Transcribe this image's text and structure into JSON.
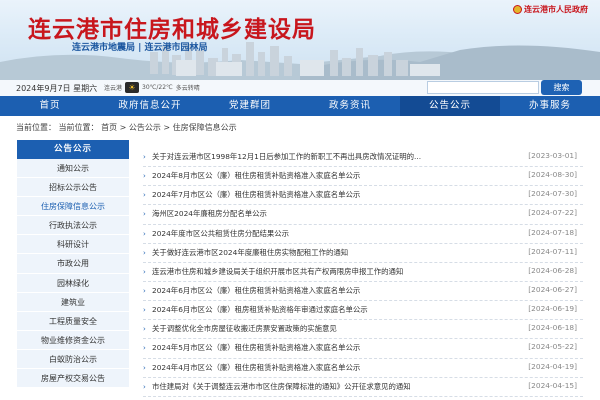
{
  "header": {
    "site_title": "连云港市住房和城乡建设局",
    "site_subtitle": "连云港市地震局 | 连云港市园林局",
    "gov_link": "连云港市人民政府"
  },
  "infobar": {
    "date": "2024年9月7日 星期六",
    "city": "连云港",
    "temperature": "30℃/22℃",
    "weather": "多云转晴",
    "search_placeholder": "",
    "search_label": "搜索"
  },
  "nav": {
    "items": [
      "首页",
      "政府信息公开",
      "党建群团",
      "政务资讯",
      "公告公示",
      "办事服务"
    ],
    "active_index": 4
  },
  "breadcrumb": "当前位置：  当前位置： 首页 > 公告公示 > 住房保障信息公示",
  "sidebar": {
    "title": "公告公示",
    "items": [
      "通知公示",
      "招标公示公告",
      "住房保障信息公示",
      "行政执法公示",
      "科研设计",
      "市政公用",
      "园林绿化",
      "建筑业",
      "工程质量安全",
      "物业维修资金公示",
      "白蚁防治公示",
      "房屋产权交易公告"
    ],
    "active_index": 2
  },
  "list": [
    {
      "title": "关于对连云港市区1998年12月1日后参加工作的新职工不再出具房改情况证明的...",
      "date": "[2023-03-01]"
    },
    {
      "title": "2024年8月市区公（廉）租住房租赁补贴资格准入家庭名单公示",
      "date": "[2024-08-30]"
    },
    {
      "title": "2024年7月市区公（廉）租住房租赁补贴资格准入家庭名单公示",
      "date": "[2024-07-30]"
    },
    {
      "title": "海州区2024年廉租房分配名单公示",
      "date": "[2024-07-22]"
    },
    {
      "title": "2024年度市区公共租赁住房分配结果公示",
      "date": "[2024-07-18]"
    },
    {
      "title": "关于做好连云港市区2024年度廉租住房实物配租工作的通知",
      "date": "[2024-07-11]"
    },
    {
      "title": "连云港市住房和城乡建设局关于组织开展市区共有产权两限房申报工作的通知",
      "date": "[2024-06-28]"
    },
    {
      "title": "2024年6月市区公（廉）租住房租赁补贴资格准入家庭名单公示",
      "date": "[2024-06-27]"
    },
    {
      "title": "2024年6月市区公（廉）租房租赁补贴资格年审通过家庭名单公示",
      "date": "[2024-06-19]"
    },
    {
      "title": "关于调整优化全市房屋征收搬迁房票安置政策的实施意见",
      "date": "[2024-06-18]"
    },
    {
      "title": "2024年5月市区公（廉）租住房租赁补贴资格准入家庭名单公示",
      "date": "[2024-05-22]"
    },
    {
      "title": "2024年4月市区公（廉）租住房租赁补贴资格准入家庭名单公示",
      "date": "[2024-04-19]"
    },
    {
      "title": "市住建局对《关于调整连云港市市区住房保障标准的通知》公开征求意见的通知",
      "date": "[2024-04-15]"
    }
  ],
  "colors": {
    "brand_red": "#c8161d",
    "nav_blue": "#1c5fb1",
    "sidebar_bg": "#eef4fb"
  },
  "icons": {
    "weather": "sun-cloud-icon",
    "emblem": "national-emblem-icon",
    "bullet": "chevron-right-icon"
  }
}
